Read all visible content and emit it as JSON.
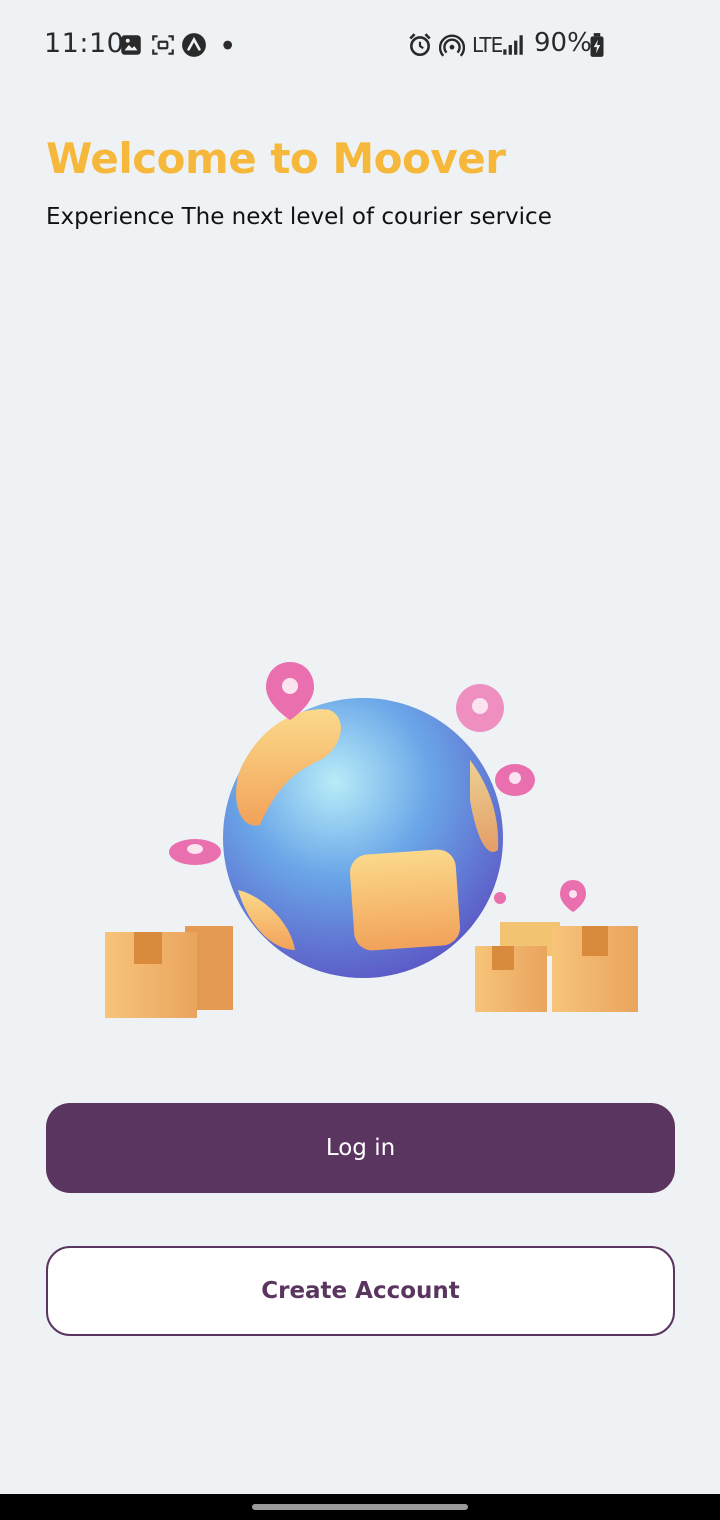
{
  "status_bar": {
    "time": "11:10",
    "network": "LTE",
    "battery": "90%",
    "icons": [
      "image-icon",
      "screen-record-icon",
      "app-icon",
      "dot-icon",
      "alarm-icon",
      "hotspot-icon",
      "signal-icon",
      "battery-charging-icon"
    ]
  },
  "welcome": {
    "title": "Welcome to Moover",
    "subtitle": "Experience The next level of courier service"
  },
  "illustration": {
    "name": "globe-with-packages-and-location-pins"
  },
  "actions": {
    "login_label": "Log in",
    "create_account_label": "Create Account"
  },
  "colors": {
    "background": "#eef2f5",
    "accent_yellow": "#f6b83a",
    "primary_purple": "#5a3560",
    "pin_pink": "#ea6fae",
    "globe_blue": "#5b86d8"
  }
}
